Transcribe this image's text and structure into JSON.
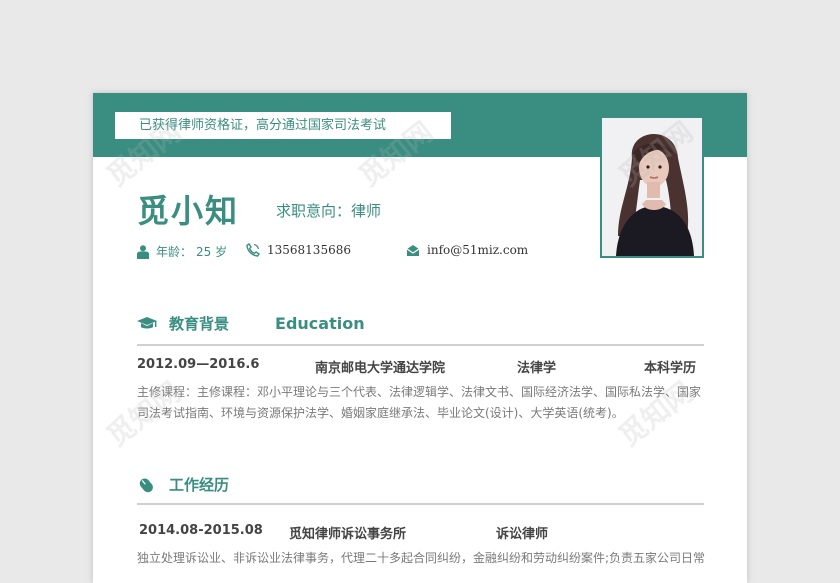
{
  "banner": {
    "text": "已获得律师资格证，高分通过国家司法考试"
  },
  "profile": {
    "name": "觅小知",
    "intent_label": "求职意向：律师",
    "age_label": "年龄：",
    "age_value": "25 岁",
    "phone": "13568135686",
    "email": "info@51miz.com"
  },
  "education": {
    "title": "教育背景",
    "title_en": "Education",
    "period": "2012.09—2016.6",
    "school": "南京邮电大学通达学院",
    "major": "法律学",
    "degree": "本科学历",
    "description": "主修课程：主修课程：邓小平理论与三个代表、法律逻辑学、法律文书、国际经济法学、国际私法学、国家司法考试指南、环境与资源保护法学、婚姻家庭继承法、毕业论文(设计)、大学英语(统考)。"
  },
  "work": {
    "title": "工作经历",
    "period": "2014.08-2015.08",
    "company": "觅知律师诉讼事务所",
    "position": "诉讼律师",
    "description": "独立处理诉讼业、非诉讼业法律事务，代理二十多起合同纠纷，金融纠纷和劳动纠纷案件;负责五家公司日常"
  },
  "watermark": {
    "text": "觅知网"
  },
  "colors": {
    "accent": "#3a8e81",
    "rule": "#d0d0d0",
    "text": "#444444",
    "muted": "#7a7a7a"
  },
  "icons": [
    "person-icon",
    "phone-icon",
    "mail-icon",
    "graduation-cap-icon",
    "mouse-icon"
  ]
}
